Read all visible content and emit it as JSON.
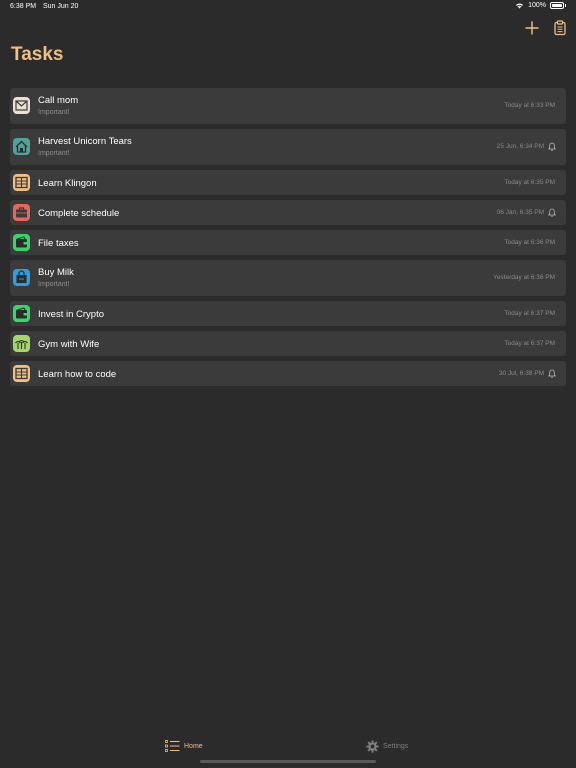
{
  "status_bar": {
    "time": "6:38 PM",
    "date": "Sun Jun 20",
    "battery": "100%"
  },
  "header": {
    "title": "Tasks",
    "add_icon": "plus-icon",
    "clipboard_icon": "clipboard-icon"
  },
  "tasks": [
    {
      "title": "Call mom",
      "subtitle": "Important!",
      "time": "Today at 6:33 PM",
      "icon": "envelope-icon",
      "color": "#e9e1d3"
    },
    {
      "title": "Harvest Unicorn Tears",
      "subtitle": "Important!",
      "time": "25 Jun, 6:34 PM",
      "icon": "house-icon",
      "color": "#4ea39a"
    },
    {
      "title": "Learn Klingon",
      "time": "Today at 6:35 PM",
      "icon": "book-icon",
      "color": "#f2be82"
    },
    {
      "title": "Complete schedule",
      "time": "06 Jan, 6:35 PM",
      "icon": "briefcase-icon",
      "color": "#e8665a"
    },
    {
      "title": "File taxes",
      "time": "Today at 6:36 PM",
      "icon": "wallet-icon",
      "color": "#33d86a"
    },
    {
      "title": "Buy Milk",
      "subtitle": "Important!",
      "time": "Yesterday at 6:36 PM",
      "icon": "shopping-bag-icon",
      "color": "#2d9de6"
    },
    {
      "title": "Invest in Crypto",
      "time": "Today at 6:37 PM",
      "icon": "wallet-icon",
      "color": "#33d86a"
    },
    {
      "title": "Gym with Wife",
      "time": "Today at 6:37 PM",
      "icon": "palm-tree-icon",
      "color": "#a6d66b"
    },
    {
      "title": "Learn how to code",
      "time": "30 Jul, 6:38 PM",
      "icon": "book-icon",
      "color": "#f2be82"
    }
  ],
  "tab_bar": {
    "home_label": "Home",
    "settings_label": "Settings"
  },
  "colors": {
    "accent": "#f2be82",
    "background": "#2b2b2b",
    "row": "#3b3b3b"
  }
}
